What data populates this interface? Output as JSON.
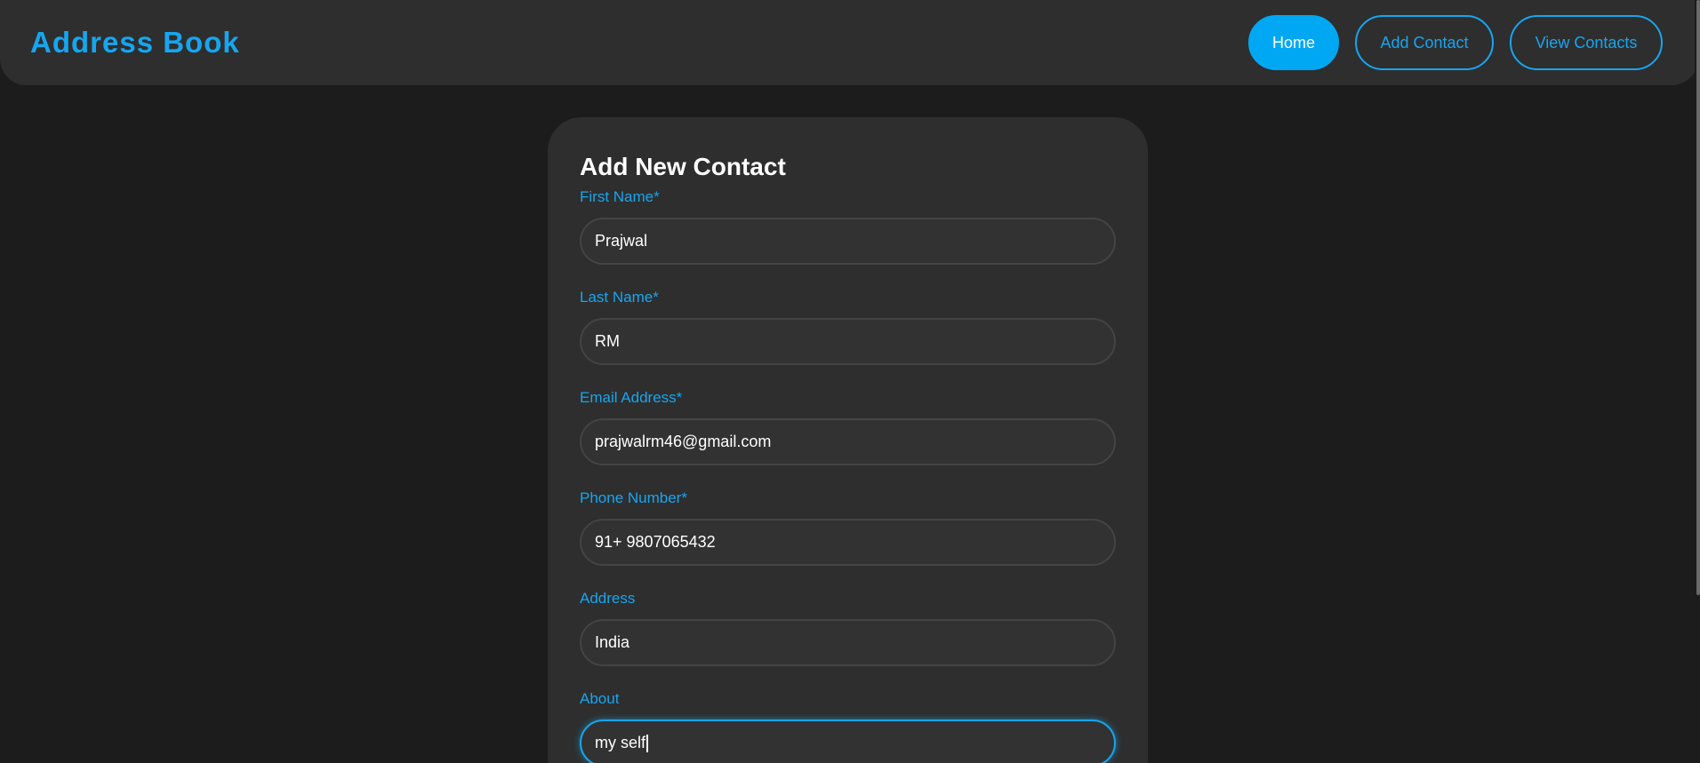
{
  "header": {
    "brand": "Address Book",
    "nav": {
      "home": "Home",
      "add_contact": "Add Contact",
      "view_contacts": "View Contacts"
    }
  },
  "form": {
    "title": "Add New Contact",
    "fields": {
      "first_name": {
        "label": "First Name*",
        "value": "Prajwal"
      },
      "last_name": {
        "label": "Last Name*",
        "value": "RM"
      },
      "email": {
        "label": "Email Address*",
        "value": "prajwalrm46@gmail.com"
      },
      "phone": {
        "label": "Phone Number*",
        "value": "91+ 9807065432"
      },
      "address": {
        "label": "Address",
        "value": "India"
      },
      "about": {
        "label": "About",
        "value": "my self"
      }
    }
  },
  "colors": {
    "accent": "#16a6f0",
    "background": "#1c1c1c",
    "surface": "#2e2e2e"
  }
}
